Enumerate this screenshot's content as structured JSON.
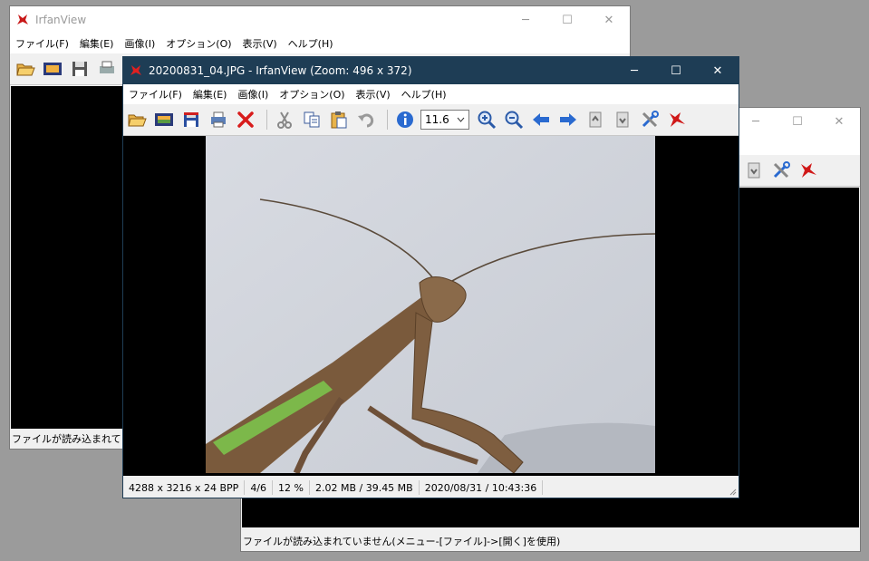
{
  "back_window_1": {
    "title": "IrfanView",
    "menu": [
      "ファイル(F)",
      "編集(E)",
      "画像(I)",
      "オプション(O)",
      "表示(V)",
      "ヘルプ(H)"
    ],
    "status": "ファイルが読み込まれていません(メニュー-[ファイル]->[開く]を使用)"
  },
  "back_window_2": {
    "status": "ファイルが読み込まれていません(メニュー-[ファイル]->[開く]を使用)"
  },
  "main_window": {
    "title": "20200831_04.JPG - IrfanView (Zoom: 496 x 372)",
    "menu": [
      "ファイル(F)",
      "編集(E)",
      "画像(I)",
      "オプション(O)",
      "表示(V)",
      "ヘルプ(H)"
    ],
    "zoom_value": "11.6",
    "status": {
      "dimensions": "4288 x 3216 x 24 BPP",
      "index": "4/6",
      "zoom": "12 %",
      "size": "2.02 MB / 39.45 MB",
      "datetime": "2020/08/31 / 10:43:36"
    }
  },
  "window_controls": {
    "minimize": "─",
    "maximize": "☐",
    "close": "✕"
  },
  "colors": {
    "titlebar_active": "#1e3d55",
    "desktop": "#9b9b9b"
  }
}
